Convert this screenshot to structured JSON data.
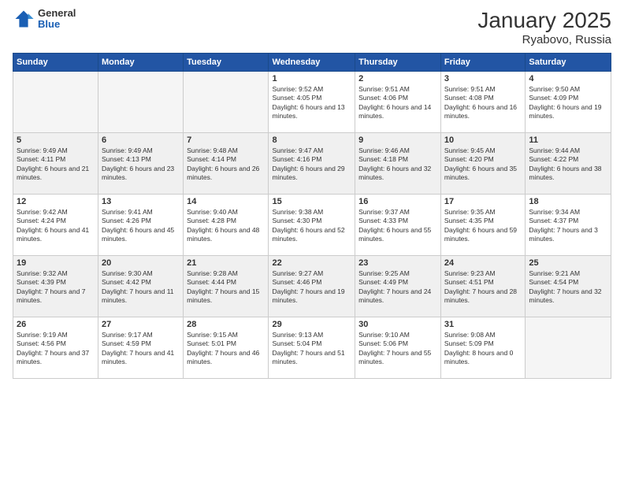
{
  "logo": {
    "general": "General",
    "blue": "Blue"
  },
  "title": "January 2025",
  "subtitle": "Ryabovo, Russia",
  "days_of_week": [
    "Sunday",
    "Monday",
    "Tuesday",
    "Wednesday",
    "Thursday",
    "Friday",
    "Saturday"
  ],
  "weeks": [
    [
      {
        "day": "",
        "empty": true
      },
      {
        "day": "",
        "empty": true
      },
      {
        "day": "",
        "empty": true
      },
      {
        "day": "1",
        "sunrise": "9:52 AM",
        "sunset": "4:05 PM",
        "daylight": "6 hours and 13 minutes."
      },
      {
        "day": "2",
        "sunrise": "9:51 AM",
        "sunset": "4:06 PM",
        "daylight": "6 hours and 14 minutes."
      },
      {
        "day": "3",
        "sunrise": "9:51 AM",
        "sunset": "4:08 PM",
        "daylight": "6 hours and 16 minutes."
      },
      {
        "day": "4",
        "sunrise": "9:50 AM",
        "sunset": "4:09 PM",
        "daylight": "6 hours and 19 minutes."
      }
    ],
    [
      {
        "day": "5",
        "sunrise": "9:49 AM",
        "sunset": "4:11 PM",
        "daylight": "6 hours and 21 minutes."
      },
      {
        "day": "6",
        "sunrise": "9:49 AM",
        "sunset": "4:13 PM",
        "daylight": "6 hours and 23 minutes."
      },
      {
        "day": "7",
        "sunrise": "9:48 AM",
        "sunset": "4:14 PM",
        "daylight": "6 hours and 26 minutes."
      },
      {
        "day": "8",
        "sunrise": "9:47 AM",
        "sunset": "4:16 PM",
        "daylight": "6 hours and 29 minutes."
      },
      {
        "day": "9",
        "sunrise": "9:46 AM",
        "sunset": "4:18 PM",
        "daylight": "6 hours and 32 minutes."
      },
      {
        "day": "10",
        "sunrise": "9:45 AM",
        "sunset": "4:20 PM",
        "daylight": "6 hours and 35 minutes."
      },
      {
        "day": "11",
        "sunrise": "9:44 AM",
        "sunset": "4:22 PM",
        "daylight": "6 hours and 38 minutes."
      }
    ],
    [
      {
        "day": "12",
        "sunrise": "9:42 AM",
        "sunset": "4:24 PM",
        "daylight": "6 hours and 41 minutes."
      },
      {
        "day": "13",
        "sunrise": "9:41 AM",
        "sunset": "4:26 PM",
        "daylight": "6 hours and 45 minutes."
      },
      {
        "day": "14",
        "sunrise": "9:40 AM",
        "sunset": "4:28 PM",
        "daylight": "6 hours and 48 minutes."
      },
      {
        "day": "15",
        "sunrise": "9:38 AM",
        "sunset": "4:30 PM",
        "daylight": "6 hours and 52 minutes."
      },
      {
        "day": "16",
        "sunrise": "9:37 AM",
        "sunset": "4:33 PM",
        "daylight": "6 hours and 55 minutes."
      },
      {
        "day": "17",
        "sunrise": "9:35 AM",
        "sunset": "4:35 PM",
        "daylight": "6 hours and 59 minutes."
      },
      {
        "day": "18",
        "sunrise": "9:34 AM",
        "sunset": "4:37 PM",
        "daylight": "7 hours and 3 minutes."
      }
    ],
    [
      {
        "day": "19",
        "sunrise": "9:32 AM",
        "sunset": "4:39 PM",
        "daylight": "7 hours and 7 minutes."
      },
      {
        "day": "20",
        "sunrise": "9:30 AM",
        "sunset": "4:42 PM",
        "daylight": "7 hours and 11 minutes."
      },
      {
        "day": "21",
        "sunrise": "9:28 AM",
        "sunset": "4:44 PM",
        "daylight": "7 hours and 15 minutes."
      },
      {
        "day": "22",
        "sunrise": "9:27 AM",
        "sunset": "4:46 PM",
        "daylight": "7 hours and 19 minutes."
      },
      {
        "day": "23",
        "sunrise": "9:25 AM",
        "sunset": "4:49 PM",
        "daylight": "7 hours and 24 minutes."
      },
      {
        "day": "24",
        "sunrise": "9:23 AM",
        "sunset": "4:51 PM",
        "daylight": "7 hours and 28 minutes."
      },
      {
        "day": "25",
        "sunrise": "9:21 AM",
        "sunset": "4:54 PM",
        "daylight": "7 hours and 32 minutes."
      }
    ],
    [
      {
        "day": "26",
        "sunrise": "9:19 AM",
        "sunset": "4:56 PM",
        "daylight": "7 hours and 37 minutes."
      },
      {
        "day": "27",
        "sunrise": "9:17 AM",
        "sunset": "4:59 PM",
        "daylight": "7 hours and 41 minutes."
      },
      {
        "day": "28",
        "sunrise": "9:15 AM",
        "sunset": "5:01 PM",
        "daylight": "7 hours and 46 minutes."
      },
      {
        "day": "29",
        "sunrise": "9:13 AM",
        "sunset": "5:04 PM",
        "daylight": "7 hours and 51 minutes."
      },
      {
        "day": "30",
        "sunrise": "9:10 AM",
        "sunset": "5:06 PM",
        "daylight": "7 hours and 55 minutes."
      },
      {
        "day": "31",
        "sunrise": "9:08 AM",
        "sunset": "5:09 PM",
        "daylight": "8 hours and 0 minutes."
      },
      {
        "day": "",
        "empty": true
      }
    ]
  ]
}
